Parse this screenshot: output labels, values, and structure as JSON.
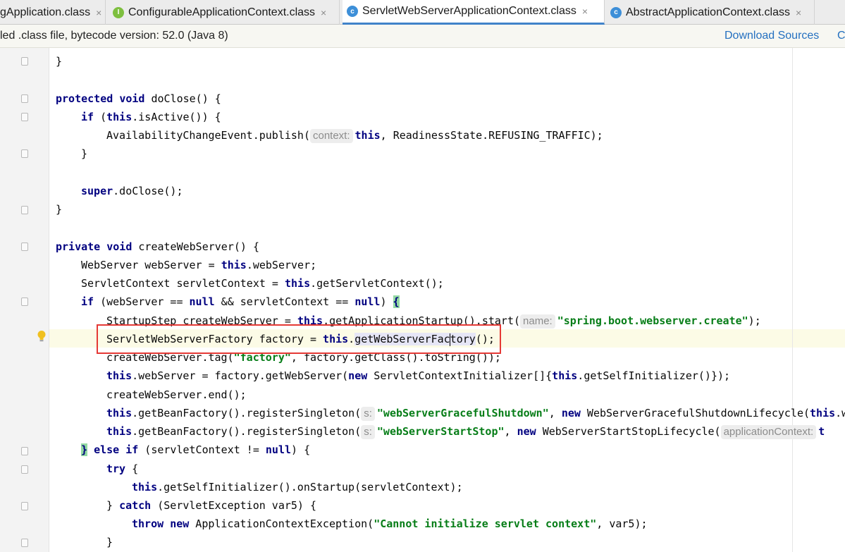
{
  "tabs": [
    {
      "name": "tab-application",
      "label": "gApplication.class",
      "icon": "",
      "icon_color": "",
      "active": false
    },
    {
      "name": "tab-configurable-application-context",
      "label": "ConfigurableApplicationContext.class",
      "icon": "I",
      "icon_color": "#7ebf3f",
      "active": false
    },
    {
      "name": "tab-servlet-web-server-application-context",
      "label": "ServletWebServerApplicationContext.class",
      "icon": "c",
      "icon_color": "#3d8fd8",
      "active": true
    },
    {
      "name": "tab-abstract-application-context",
      "label": "AbstractApplicationContext.class",
      "icon": "c",
      "icon_color": "#3d8fd8",
      "active": false
    }
  ],
  "tab_close_glyph": "×",
  "infobar": {
    "text": "led .class file, bytecode version: 52.0 (Java 8)",
    "download_sources": "Download Sources",
    "choose_sources": "C"
  },
  "colors": {
    "keyword": "#000080",
    "string": "#067d17",
    "highlight_box": "#e53935",
    "current_line": "#fcfbe6",
    "bulb": "#f0c020"
  },
  "code": {
    "l0": "        }",
    "l2_kw1": "protected",
    "l2_kw2": "void",
    "l2_rest": " doClose() {",
    "l3_kw1": "if",
    "l3_a": " (",
    "l3_kw2": "this",
    "l3_rest": ".isActive()) {",
    "l4_a": "AvailabilityChangeEvent.publish(",
    "l4_hint": "context:",
    "l4_kw": "this",
    "l4_rest": ", ReadinessState.REFUSING_TRAFFIC);",
    "l5": "}",
    "l7_kw": "super",
    "l7_rest": ".doClose();",
    "l8": "}",
    "l10_kw1": "private",
    "l10_kw2": "void",
    "l10_rest": " createWebServer() {",
    "l11_a": "WebServer webServer = ",
    "l11_kw": "this",
    "l11_rest": ".webServer;",
    "l12_a": "ServletContext servletContext = ",
    "l12_kw": "this",
    "l12_rest": ".getServletContext();",
    "l13_kw1": "if",
    "l13_a": " (webServer == ",
    "l13_kw2": "null",
    "l13_b": " && servletContext == ",
    "l13_kw3": "null",
    "l13_c": ") ",
    "l13_brace": "{",
    "l14_a": "StartupStep createWebServer = ",
    "l14_kw": "this",
    "l14_b": ".getApplicationStartup().start(",
    "l14_hint": "name:",
    "l14_str": "\"spring.boot.webserver.create\"",
    "l14_c": ");",
    "l15_a": "ServletWebServerFactory factory = ",
    "l15_kw": "this",
    "l15_dot": ".",
    "l15_method1": "getWebServerFac",
    "l15_method2": "tory",
    "l15_rest": "();",
    "l16_a": "createWebServer.tag(",
    "l16_str": "\"factory\"",
    "l16_rest": ", factory.getClass().toString());",
    "l17_kw1": "this",
    "l17_a": ".webServer = factory.getWebServer(",
    "l17_kw2": "new",
    "l17_b": " ServletContextInitializer[]{",
    "l17_kw3": "this",
    "l17_c": ".getSelfInitializer()});",
    "l18": "createWebServer.end();",
    "l19_kw1": "this",
    "l19_a": ".getBeanFactory().registerSingleton(",
    "l19_hint": "s:",
    "l19_str": "\"webServerGracefulShutdown\"",
    "l19_b": ", ",
    "l19_kw2": "new",
    "l19_c": " WebServerGracefulShutdownLifecycle(",
    "l19_kw3": "this",
    "l19_d": ".w",
    "l20_kw1": "this",
    "l20_a": ".getBeanFactory().registerSingleton(",
    "l20_hint": "s:",
    "l20_str": "\"webServerStartStop\"",
    "l20_b": ", ",
    "l20_kw2": "new",
    "l20_c": " WebServerStartStopLifecycle(",
    "l20_hint2": "applicationContext:",
    "l20_kw3": "t",
    "l21_brace": "}",
    "l21_kw1": "else",
    "l21_kw2": "if",
    "l21_a": " (servletContext != ",
    "l21_kw3": "null",
    "l21_b": ") {",
    "l22_kw": "try",
    "l22_rest": " {",
    "l23_kw": "this",
    "l23_rest": ".getSelfInitializer().onStartup(servletContext);",
    "l24_a": "} ",
    "l24_kw": "catch",
    "l24_rest": " (ServletException var5) {",
    "l25_kw1": "throw",
    "l25_kw2": "new",
    "l25_a": " ApplicationContextException(",
    "l25_str": "\"Cannot initialize servlet context\"",
    "l25_rest": ", var5);",
    "l26": "}"
  }
}
